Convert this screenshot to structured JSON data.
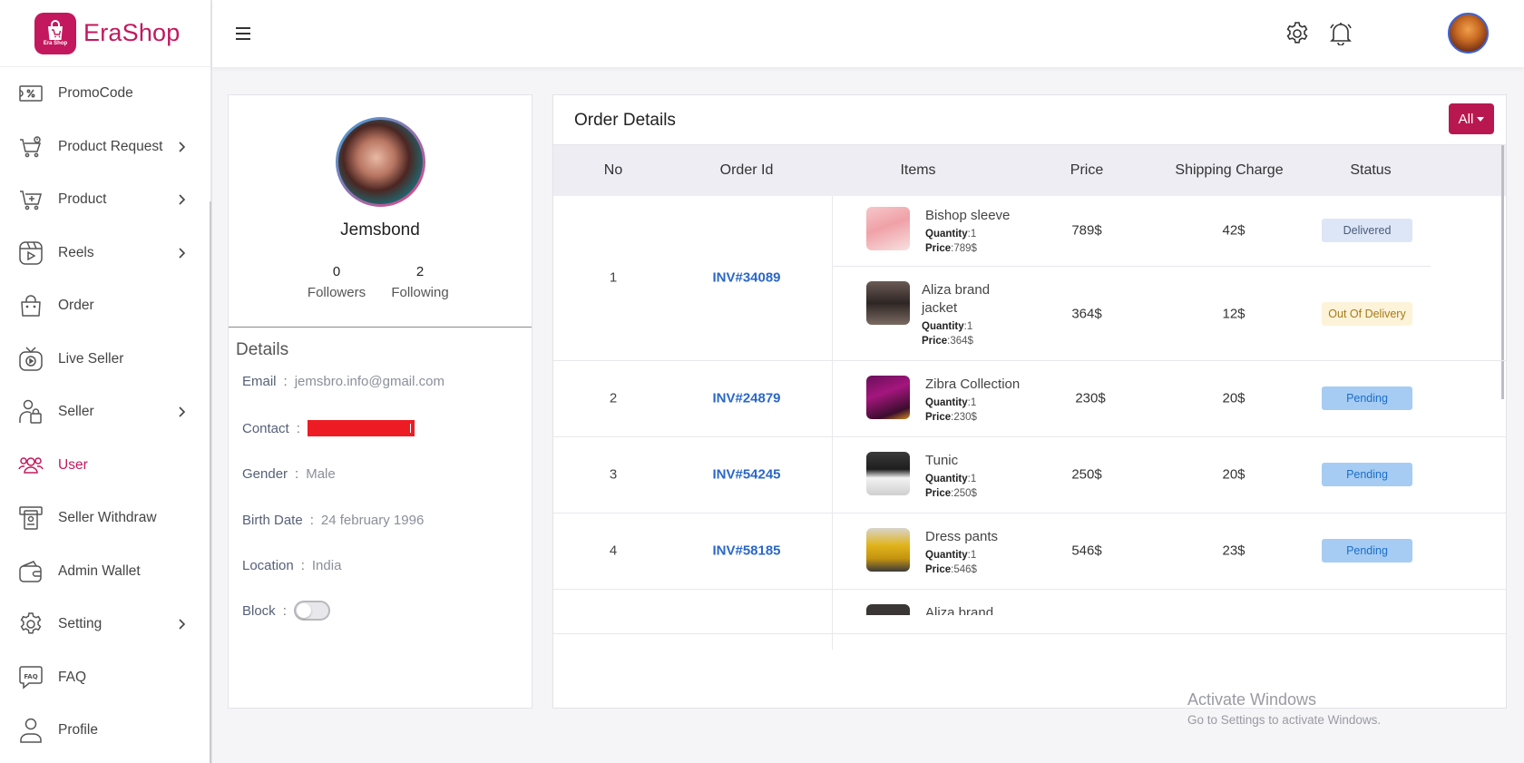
{
  "brand": {
    "name": "EraShop",
    "logo_text": "Era Shop"
  },
  "sidebar": {
    "items": [
      {
        "label": "PromoCode",
        "icon": "promocode-icon",
        "has_arrow": false,
        "active": false
      },
      {
        "label": "Product Request",
        "icon": "cart-request-icon",
        "has_arrow": true,
        "active": false
      },
      {
        "label": "Product",
        "icon": "cart-add-icon",
        "has_arrow": true,
        "active": false
      },
      {
        "label": "Reels",
        "icon": "reels-icon",
        "has_arrow": true,
        "active": false
      },
      {
        "label": "Order",
        "icon": "bag-icon",
        "has_arrow": false,
        "active": false
      },
      {
        "label": "Live Seller",
        "icon": "tv-icon",
        "has_arrow": false,
        "active": false
      },
      {
        "label": "Seller",
        "icon": "seller-icon",
        "has_arrow": true,
        "active": false
      },
      {
        "label": "User",
        "icon": "users-icon",
        "has_arrow": false,
        "active": true
      },
      {
        "label": "Seller Withdraw",
        "icon": "withdraw-icon",
        "has_arrow": false,
        "active": false
      },
      {
        "label": "Admin Wallet",
        "icon": "wallet-icon",
        "has_arrow": false,
        "active": false
      },
      {
        "label": "Setting",
        "icon": "gear-icon",
        "has_arrow": true,
        "active": false
      },
      {
        "label": "FAQ",
        "icon": "faq-icon",
        "has_arrow": false,
        "active": false
      },
      {
        "label": "Profile",
        "icon": "profile-icon",
        "has_arrow": false,
        "active": false
      }
    ]
  },
  "topbar": {
    "icons": [
      "menu-icon",
      "gear-icon",
      "bell-icon"
    ]
  },
  "profile": {
    "name": "Jemsbond",
    "followers_count": "0",
    "followers_label": "Followers",
    "following_count": "2",
    "following_label": "Following",
    "details_title": "Details",
    "email_key": "Email",
    "email": "jemsbro.info@gmail.com",
    "contact_key": "Contact",
    "gender_key": "Gender",
    "gender": "Male",
    "birth_key": "Birth Date",
    "birth": "24 february 1996",
    "location_key": "Location",
    "location": "India",
    "block_key": "Block",
    "blocked": false,
    "sep": ":"
  },
  "orders": {
    "title": "Order Details",
    "filter_label": "All",
    "columns": [
      "No",
      "Order Id",
      "Items",
      "Price",
      "Shipping Charge",
      "Status"
    ],
    "rows": [
      {
        "no": "1",
        "order_id": "INV#34089"
      },
      {
        "no": "2",
        "order_id": "INV#24879"
      },
      {
        "no": "3",
        "order_id": "INV#54245"
      },
      {
        "no": "4",
        "order_id": "INV#58185"
      }
    ],
    "items": [
      {
        "name": "Bishop sleeve",
        "qty_label": "Quantity",
        "qty": ":1",
        "price_label": "Price",
        "price_val": ":789$",
        "price": "789$",
        "shipping": "42$",
        "status": "Delivered"
      },
      {
        "name": "Aliza brand jacket",
        "qty_label": "Quantity",
        "qty": ":1",
        "price_label": "Price",
        "price_val": ":364$",
        "price": "364$",
        "shipping": "12$",
        "status": "Out Of Delivery"
      },
      {
        "name": "Zibra Collection",
        "qty_label": "Quantity",
        "qty": ":1",
        "price_label": "Price",
        "price_val": ":230$",
        "price": "230$",
        "shipping": "20$",
        "status": "Pending"
      },
      {
        "name": "Tunic",
        "qty_label": "Quantity",
        "qty": ":1",
        "price_label": "Price",
        "price_val": ":250$",
        "price": "250$",
        "shipping": "20$",
        "status": "Pending"
      },
      {
        "name": "Dress pants",
        "qty_label": "Quantity",
        "qty": ":1",
        "price_label": "Price",
        "price_val": ":546$",
        "price": "546$",
        "shipping": "23$",
        "status": "Pending"
      },
      {
        "name": "Aliza brand"
      }
    ]
  },
  "watermark": {
    "line1": "Activate Windows",
    "line2": "Go to Settings to activate Windows."
  },
  "colors": {
    "accent": "#c3185d",
    "link": "#2a67c9",
    "header_bg": "#ededf3"
  }
}
